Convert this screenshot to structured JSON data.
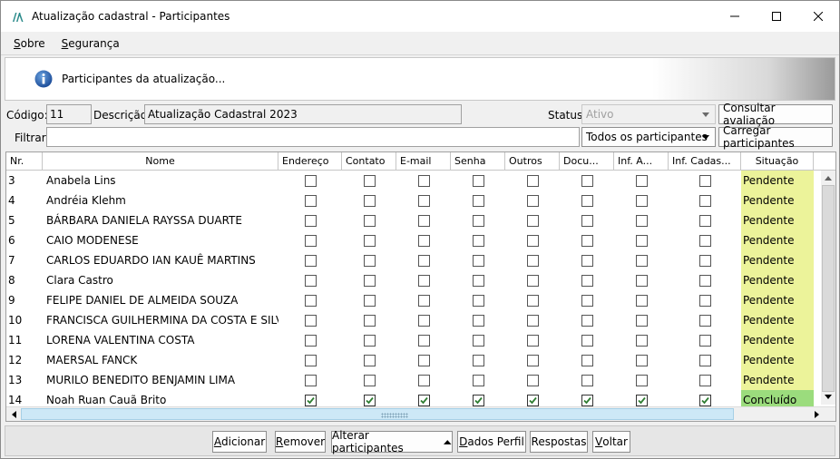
{
  "window": {
    "title": "Atualização cadastral - Participantes",
    "controls": {
      "minimize": "—",
      "maximize": "☐",
      "close": "✕"
    }
  },
  "menu": [
    {
      "label": "Sobre",
      "mnemonic": "S"
    },
    {
      "label": "Segurança",
      "mnemonic": "S"
    }
  ],
  "banner": {
    "text": "Participantes da atualização..."
  },
  "form": {
    "codigo_label": "Código:",
    "codigo_value": "11",
    "descricao_label": "Descrição:",
    "descricao_value": "Atualização Cadastral 2023",
    "status_label": "Status:",
    "status_value": "Ativo",
    "consultar_button": "Consultar avaliação",
    "filtrar_label": "Filtrar:",
    "filtrar_value": "",
    "filter_combo_value": "Todos os participantes",
    "carregar_button": "Carregar participantes"
  },
  "table": {
    "columns": [
      "Nr.",
      "Nome",
      "Endereço",
      "Contato",
      "E-mail",
      "Senha",
      "Outros",
      "Docu...",
      "Inf. A...",
      "Inf. Cadas...",
      "Situação"
    ],
    "rows": [
      {
        "nr": "3",
        "nome": "Anabela Lins",
        "checks": [
          false,
          false,
          false,
          false,
          false,
          false,
          false,
          false
        ],
        "situacao": "Pendente"
      },
      {
        "nr": "4",
        "nome": "Andréia Klehm",
        "checks": [
          false,
          false,
          false,
          false,
          false,
          false,
          false,
          false
        ],
        "situacao": "Pendente"
      },
      {
        "nr": "5",
        "nome": "BÁRBARA DANIELA RAYSSA DUARTE",
        "checks": [
          false,
          false,
          false,
          false,
          false,
          false,
          false,
          false
        ],
        "situacao": "Pendente"
      },
      {
        "nr": "6",
        "nome": "CAIO MODENESE",
        "checks": [
          false,
          false,
          false,
          false,
          false,
          false,
          false,
          false
        ],
        "situacao": "Pendente"
      },
      {
        "nr": "7",
        "nome": "CARLOS EDUARDO IAN KAUÊ MARTINS",
        "checks": [
          false,
          false,
          false,
          false,
          false,
          false,
          false,
          false
        ],
        "situacao": "Pendente"
      },
      {
        "nr": "8",
        "nome": "Clara Castro",
        "checks": [
          false,
          false,
          false,
          false,
          false,
          false,
          false,
          false
        ],
        "situacao": "Pendente"
      },
      {
        "nr": "9",
        "nome": "FELIPE DANIEL DE ALMEIDA SOUZA",
        "checks": [
          false,
          false,
          false,
          false,
          false,
          false,
          false,
          false
        ],
        "situacao": "Pendente"
      },
      {
        "nr": "10",
        "nome": "FRANCISCA GUILHERMINA DA COSTA E SILVA",
        "checks": [
          false,
          false,
          false,
          false,
          false,
          false,
          false,
          false
        ],
        "situacao": "Pendente"
      },
      {
        "nr": "11",
        "nome": "LORENA VALENTINA COSTA",
        "checks": [
          false,
          false,
          false,
          false,
          false,
          false,
          false,
          false
        ],
        "situacao": "Pendente"
      },
      {
        "nr": "12",
        "nome": "MAERSAL FANCK",
        "checks": [
          false,
          false,
          false,
          false,
          false,
          false,
          false,
          false
        ],
        "situacao": "Pendente"
      },
      {
        "nr": "13",
        "nome": "MURILO BENEDITO BENJAMIN LIMA",
        "checks": [
          false,
          false,
          false,
          false,
          false,
          false,
          false,
          false
        ],
        "situacao": "Pendente"
      },
      {
        "nr": "14",
        "nome": "Noah Ruan Cauã Brito",
        "checks": [
          true,
          true,
          true,
          true,
          true,
          true,
          true,
          true
        ],
        "situacao": "Concluído"
      }
    ]
  },
  "bottom_buttons": {
    "adicionar": "Adicionar",
    "remover": "Remover",
    "alterar": "Alterar participantes",
    "dados": "Dados Perfil",
    "respostas": "Respostas",
    "voltar": "Voltar"
  },
  "colors": {
    "pending": "#ecf39a",
    "done": "#9bdc7d",
    "check": "#2e7d32"
  },
  "icons": {
    "app": "app-logo-icon",
    "info": "info-icon",
    "combo": "chevron-down-icon",
    "alterar": "caret-up-icon"
  }
}
